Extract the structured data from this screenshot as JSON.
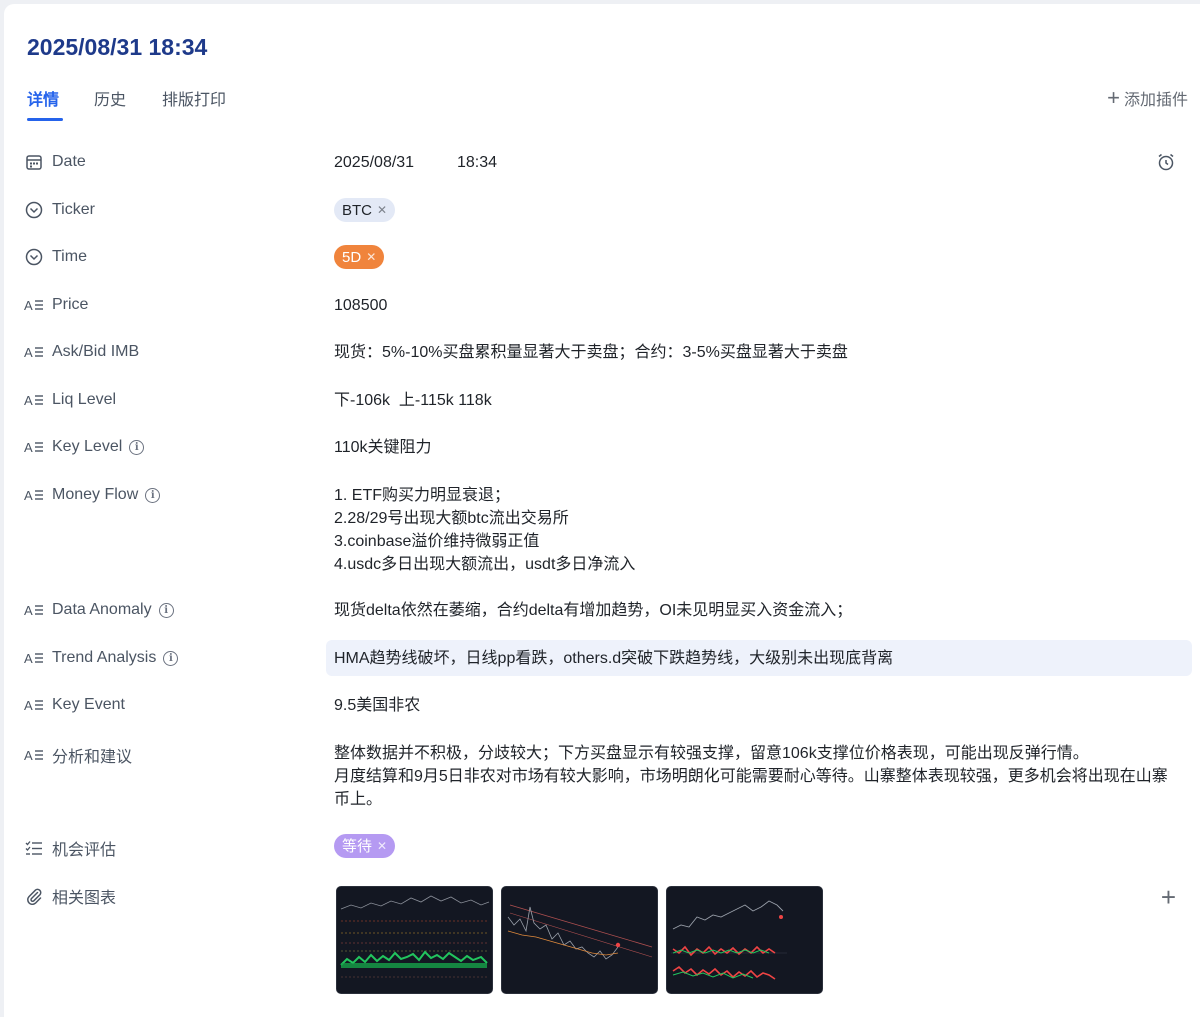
{
  "header": {
    "title": "2025/08/31 18:34",
    "tabs": [
      "详情",
      "历史",
      "排版打印"
    ],
    "add_plugin": "添加插件"
  },
  "fields": {
    "date": {
      "label": "Date",
      "date": "2025/08/31",
      "time": "18:34"
    },
    "ticker": {
      "label": "Ticker",
      "tag": "BTC"
    },
    "time": {
      "label": "Time",
      "tag": "5D"
    },
    "price": {
      "label": "Price",
      "value": "108500"
    },
    "askbid": {
      "label": "Ask/Bid IMB",
      "value": "现货：5%-10%买盘累积量显著大于卖盘；合约：3-5%买盘显著大于卖盘"
    },
    "liq": {
      "label": "Liq Level",
      "value": "下-106k  上-115k 118k"
    },
    "key_level": {
      "label": "Key Level",
      "value": "110k关键阻力"
    },
    "money_flow": {
      "label": "Money Flow",
      "lines": [
        "1. ETF购买力明显衰退；",
        "2.28/29号出现大额btc流出交易所",
        "3.coinbase溢价维持微弱正值",
        "4.usdc多日出现大额流出，usdt多日净流入"
      ]
    },
    "data_anomaly": {
      "label": "Data Anomaly",
      "value": "现货delta依然在萎缩，合约delta有增加趋势，OI未见明显买入资金流入；"
    },
    "trend": {
      "label": "Trend Analysis",
      "value": "HMA趋势线破坏，日线pp看跌，others.d突破下跌趋势线，大级别未出现底背离"
    },
    "key_event": {
      "label": "Key Event",
      "value": "9.5美国非农"
    },
    "analysis": {
      "label": "分析和建议",
      "lines": [
        "整体数据并不积极，分歧较大；下方买盘显示有较强支撑，留意106k支撑位价格表现，可能出现反弹行情。",
        "月度结算和9月5日非农对市场有较大影响，市场明朗化可能需要耐心等待。山寨整体表现较强，更多机会将出现在山寨币上。"
      ]
    },
    "opportunity": {
      "label": "机会评估",
      "tag": "等待"
    },
    "charts": {
      "label": "相关图表"
    }
  },
  "colors": {
    "accent": "#2563eb",
    "title": "#1e3a8a",
    "tag_5d": "#f0843c",
    "tag_wait": "#b59af2",
    "tag_btc": "#e3e9f6"
  }
}
